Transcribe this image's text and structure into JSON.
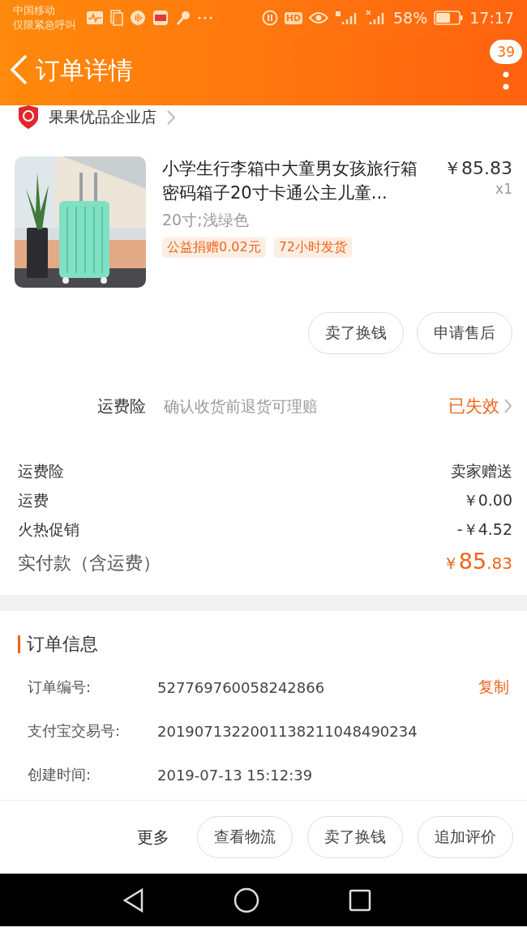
{
  "status_bar": {
    "carrier": "中国移动",
    "carrier_note": "仅限紧急呼叫",
    "hd": "HD",
    "battery": "58%",
    "time": "17:17"
  },
  "header": {
    "title": "订单详情",
    "badge": "39"
  },
  "shop": {
    "name": "果果优品企业店"
  },
  "product": {
    "image": {
      "kind": "picture"
    },
    "title": "小学生行李箱中大童男女孩旅行箱密码箱子20寸卡通公主儿童...",
    "price": "￥85.83",
    "quantity": "x1",
    "spec": "20寸;浅绿色",
    "tags": [
      "公益捐赠0.02元",
      "72小时发货"
    ]
  },
  "item_actions": [
    "卖了换钱",
    "申请售后"
  ],
  "insurance": {
    "label": "运费险",
    "description": "确认收货前退货可理赔",
    "status": "已失效"
  },
  "fees": [
    {
      "label": "运费险",
      "value": "卖家赠送"
    },
    {
      "label": "运费",
      "value": "￥0.00"
    },
    {
      "label": "火热促销",
      "value": "-￥4.52"
    }
  ],
  "total": {
    "label": "实付款（含运费）",
    "currency": "￥",
    "integer": "85",
    "decimal": ".83"
  },
  "order_info": {
    "title": "订单信息",
    "rows": [
      {
        "label": "订单编号:",
        "value": "527769760058242866",
        "action": "复制"
      },
      {
        "label": "支付宝交易号:",
        "value": "2019071322001138211048490234"
      },
      {
        "label": "创建时间:",
        "value": "2019-07-13 15:12:39"
      }
    ]
  },
  "bottom_actions": {
    "more": "更多",
    "buttons": [
      "查看物流",
      "卖了换钱",
      "追加评价"
    ]
  }
}
